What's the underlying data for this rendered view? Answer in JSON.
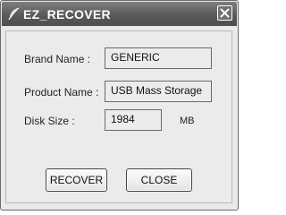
{
  "window": {
    "title": "EZ_RECOVER",
    "title_bar_color": "#5f5f5f"
  },
  "icons": {
    "app": "feather-icon",
    "close": "close-icon"
  },
  "form": {
    "brand_name": {
      "label": "Brand Name :",
      "value": "GENERIC"
    },
    "product_name": {
      "label": "Product Name :",
      "value": "USB Mass Storage"
    },
    "disk_size": {
      "label": "Disk Size :",
      "value": "1984",
      "unit": "MB"
    }
  },
  "buttons": {
    "recover": "RECOVER",
    "close": "CLOSE"
  }
}
